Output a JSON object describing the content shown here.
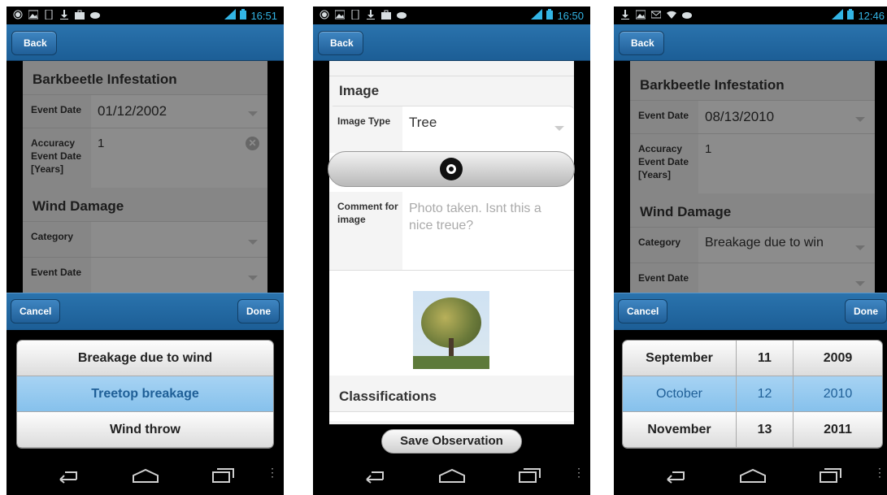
{
  "phone1": {
    "status_time": "16:51",
    "back_label": "Back",
    "section1_title": "Barkbeetle Infestation",
    "event_date_label": "Event Date",
    "event_date_value": "01/12/2002",
    "accuracy_label": "Accuracy Event Date [Years]",
    "accuracy_value": "1",
    "section2_title": "Wind Damage",
    "category_label": "Category",
    "event_date2_label": "Event Date",
    "cancel_label": "Cancel",
    "done_label": "Done",
    "options": [
      "Breakage due to wind",
      "Treetop breakage",
      "Wind throw"
    ],
    "selected_index": 1
  },
  "phone2": {
    "status_time": "16:50",
    "back_label": "Back",
    "image_section_title": "Image",
    "image_type_label": "Image Type",
    "image_type_value": "Tree",
    "comment_label": "Comment for image",
    "comment_value": "Photo taken. Isnt this a nice treue?",
    "classifications_title": "Classifications",
    "save_label": "Save Observation"
  },
  "phone3": {
    "status_time": "12:46",
    "back_label": "Back",
    "section1_title": "Barkbeetle Infestation",
    "event_date_label": "Event Date",
    "event_date_value": "08/13/2010",
    "accuracy_label": "Accuracy Event Date [Years]",
    "accuracy_value": "1",
    "section2_title": "Wind Damage",
    "category_label": "Category",
    "category_value": "Breakage due to win",
    "event_date2_label": "Event Date",
    "cancel_label": "Cancel",
    "done_label": "Done",
    "months": [
      "September",
      "October",
      "November"
    ],
    "days": [
      "11",
      "12",
      "13"
    ],
    "years": [
      "2009",
      "2010",
      "2011"
    ]
  },
  "colors": {
    "accent_blue": "#1c5e96",
    "selection": "#86c1ec",
    "status_time": "#33b5e5"
  }
}
